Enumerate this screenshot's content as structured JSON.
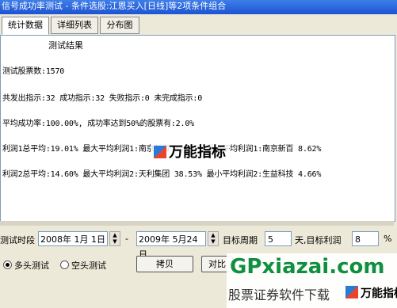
{
  "window": {
    "title": "信号成功率测试 - 条件选股:江恩买入[日线]等2项条件组合"
  },
  "tabs": [
    {
      "label": "统计数据",
      "active": true
    },
    {
      "label": "详细列表",
      "active": false
    },
    {
      "label": "分布图",
      "active": false
    }
  ],
  "results": {
    "heading": "测试结果",
    "lines": [
      "测试股票数:1570",
      "共发出指示:32 成功指示:32 失败指示:0 未完成指示:0",
      "平均成功率:100.00%, 成功率达到50%的股票有:2.0%",
      "利润1总平均:19.01% 最大平均利润1:南京新百 45.35% 最小平均利润1:南京新百 8.62%",
      "利润2总平均:14.60% 最大平均利润2:天利集团 38.53% 最小平均利润2:生益科技 4.66%"
    ]
  },
  "params": {
    "period_label": "测试时段",
    "start_date": "2008年 1月 1日",
    "dash": "-",
    "end_date": "2009年 5月24日",
    "target_period_label": "目标周期",
    "target_period_value": "5",
    "days_profit_label": "天,目标利润",
    "target_profit_value": "8",
    "percent": "%"
  },
  "options": {
    "long_test": "多头测试",
    "short_test": "空头测试",
    "long_selected": true
  },
  "buttons": {
    "copy": "拷贝",
    "compare": "对比"
  },
  "watermarks": {
    "center": "万能指标",
    "gp_domain": "GPxiazai.com",
    "gp_tagline": "股票证券软件下载",
    "gp_logo": "万能指标"
  }
}
